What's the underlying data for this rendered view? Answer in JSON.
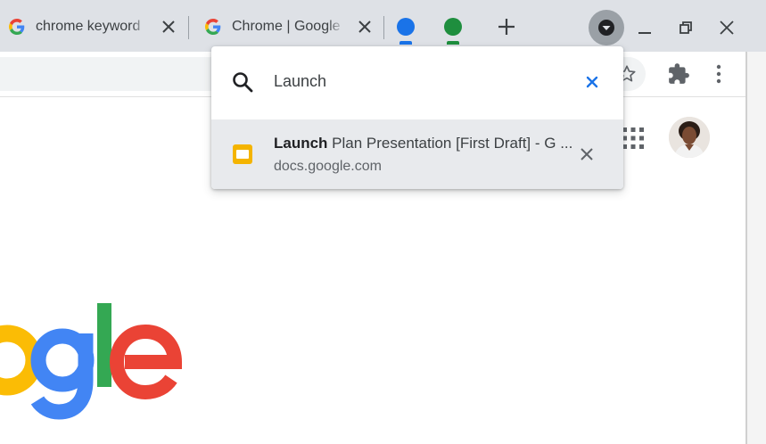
{
  "tabs": [
    {
      "title": "chrome keyword",
      "favicon": "google-g-icon"
    },
    {
      "title": "Chrome | Google",
      "favicon": "google-g-icon"
    }
  ],
  "tab_groups": [
    {
      "color": "#1a73e8"
    },
    {
      "color": "#1e8e3e"
    }
  ],
  "tab_search": {
    "query": "Launch",
    "result": {
      "title_match": "Launch",
      "title_rest": " Plan Presentation [First Draft] - Google Slides",
      "url": "docs.google.com",
      "icon": "google-slides-icon",
      "icon_color": "#f4b400"
    }
  },
  "colors": {
    "tabstrip_bg": "#dee1e6",
    "omnibox_bg": "#f1f3f4",
    "result_bg": "#e8eaed",
    "google_blue": "#4285f4",
    "google_green": "#34a853",
    "google_red": "#ea4335",
    "google_yellow": "#fbbc05"
  },
  "logo_visible_text": "ogle"
}
